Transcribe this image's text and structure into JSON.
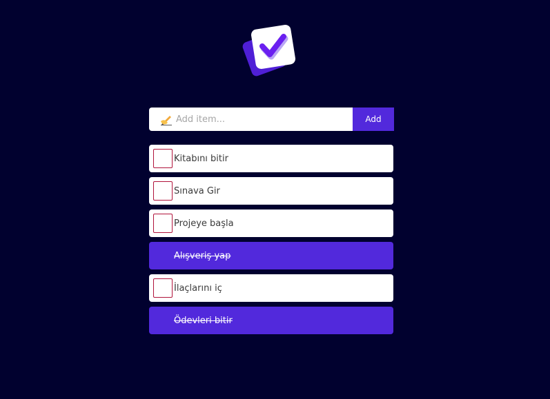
{
  "app": {
    "logo_icon": "checkmark-cards-icon",
    "accent_color": "#5229dc",
    "background_color": "#01012f"
  },
  "form": {
    "input_icon": "writing-hand-icon",
    "placeholder": "Add item...",
    "value": "",
    "add_label": "Add"
  },
  "todos": [
    {
      "text": "Kitabını bitir",
      "done": false
    },
    {
      "text": "Sınava Gir",
      "done": false
    },
    {
      "text": "Projeye başla",
      "done": false
    },
    {
      "text": "Alışveriş yap",
      "done": true
    },
    {
      "text": "İlaçlarını iç",
      "done": false
    },
    {
      "text": "Ödevleri bitir",
      "done": true
    }
  ]
}
